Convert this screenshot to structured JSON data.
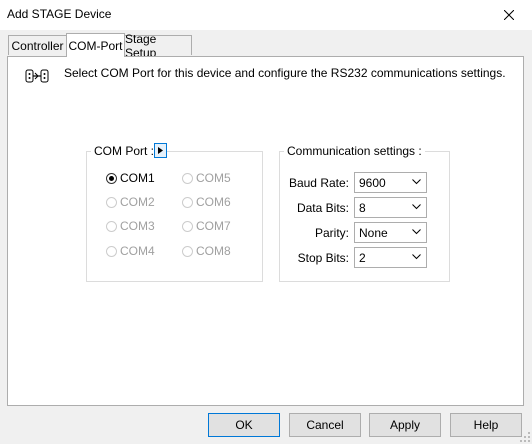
{
  "window": {
    "title": "Add STAGE Device"
  },
  "tabs": [
    {
      "label": "Controller"
    },
    {
      "label": "COM-Port"
    },
    {
      "label": "Stage Setup"
    }
  ],
  "intro": {
    "text": "Select COM Port for this device and configure the RS232 communications settings."
  },
  "com_port": {
    "label": "COM Port :",
    "options": [
      "COM1",
      "COM2",
      "COM3",
      "COM4",
      "COM5",
      "COM6",
      "COM7",
      "COM8"
    ],
    "selected": "COM1"
  },
  "comm_settings": {
    "label": "Communication settings :",
    "fields": [
      {
        "label": "Baud Rate:",
        "value": "9600"
      },
      {
        "label": "Data Bits:",
        "value": "8"
      },
      {
        "label": "Parity:",
        "value": "None"
      },
      {
        "label": "Stop Bits:",
        "value": "2"
      }
    ]
  },
  "buttons": {
    "ok": "OK",
    "cancel": "Cancel",
    "apply": "Apply",
    "help": "Help"
  },
  "colors": {
    "accent": "#0078d7",
    "panel_bg": "#ffffff",
    "window_bg": "#f0f0f0"
  }
}
